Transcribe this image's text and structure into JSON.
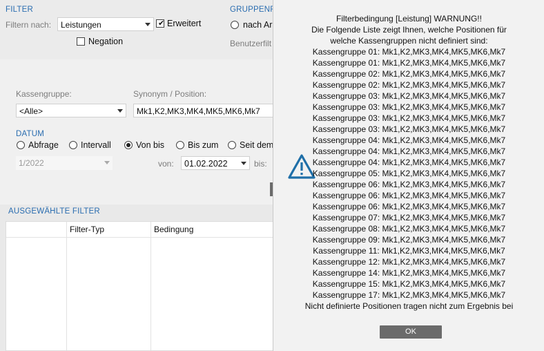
{
  "filter": {
    "title": "FILTER",
    "filter_by_label": "Filtern nach:",
    "filter_by_value": "Leistungen",
    "extended_label": "Erweitert",
    "negation_label": "Negation"
  },
  "group": {
    "title": "GRUPPENF",
    "option_label": "nach Ar",
    "user_filter_label": "Benutzerfilt"
  },
  "selection": {
    "cash_group_label": "Kassengruppe:",
    "cash_group_value": "<Alle>",
    "synonym_label": "Synonym / Position:",
    "synonym_value": "Mk1,K2,MK3,MK4,MK5,MK6,Mk7"
  },
  "date": {
    "title": "DATUM",
    "options": [
      "Abfrage",
      "Intervall",
      "Von bis",
      "Bis zum",
      "Seit dem"
    ],
    "selected": "Von bis",
    "left_combo_value": "1/2022",
    "from_label": "von:",
    "from_value": "01.02.2022",
    "to_label": "bis:"
  },
  "selected_filters": {
    "title": "AUSGEWÄHLTE FILTER",
    "columns": [
      "Filter-Typ",
      "Bedingung"
    ]
  },
  "dialog": {
    "icon": "warning-triangle-icon",
    "lines": [
      "Filterbedingung [Leistung] WARNUNG!!",
      "Die Folgende Liste zeigt Ihnen, welche Positionen für",
      "welche Kassengruppen nicht definiert sind:",
      "Kassengruppe 01: Mk1,K2,MK3,MK4,MK5,MK6,Mk7",
      "Kassengruppe 01: Mk1,K2,MK3,MK4,MK5,MK6,Mk7",
      "Kassengruppe 02: Mk1,K2,MK3,MK4,MK5,MK6,Mk7",
      "Kassengruppe 02: Mk1,K2,MK3,MK4,MK5,MK6,Mk7",
      "Kassengruppe 03: Mk1,K2,MK3,MK4,MK5,MK6,Mk7",
      "Kassengruppe 03: Mk1,K2,MK3,MK4,MK5,MK6,Mk7",
      "Kassengruppe 03: Mk1,K2,MK3,MK4,MK5,MK6,Mk7",
      "Kassengruppe 03: Mk1,K2,MK3,MK4,MK5,MK6,Mk7",
      "Kassengruppe 04: Mk1,K2,MK3,MK4,MK5,MK6,Mk7",
      "Kassengruppe 04: Mk1,K2,MK3,MK4,MK5,MK6,Mk7",
      "Kassengruppe 04: Mk1,K2,MK3,MK4,MK5,MK6,Mk7",
      "Kassengruppe 05: Mk1,K2,MK3,MK4,MK5,MK6,Mk7",
      "Kassengruppe 06: Mk1,K2,MK3,MK4,MK5,MK6,Mk7",
      "Kassengruppe 06: Mk1,K2,MK3,MK4,MK5,MK6,Mk7",
      "Kassengruppe 06: Mk1,K2,MK3,MK4,MK5,MK6,Mk7",
      "Kassengruppe 07: Mk1,K2,MK3,MK4,MK5,MK6,Mk7",
      "Kassengruppe 08: Mk1,K2,MK3,MK4,MK5,MK6,Mk7",
      "Kassengruppe 09: Mk1,K2,MK3,MK4,MK5,MK6,Mk7",
      "Kassengruppe 11: Mk1,K2,MK3,MK4,MK5,MK6,Mk7",
      "Kassengruppe 12: Mk1,K2,MK3,MK4,MK5,MK6,Mk7",
      "Kassengruppe 14: Mk1,K2,MK3,MK4,MK5,MK6,Mk7",
      "Kassengruppe 15: Mk1,K2,MK3,MK4,MK5,MK6,Mk7",
      "Kassengruppe 17: Mk1,K2,MK3,MK4,MK5,MK6,Mk7",
      "Nicht definierte Positionen tragen nicht zum Ergebnis bei"
    ],
    "ok_label": "OK"
  },
  "colors": {
    "accent": "#2a6db0",
    "warning_icon": "#1f6fa8",
    "ok_button": "#6b6b6b"
  }
}
